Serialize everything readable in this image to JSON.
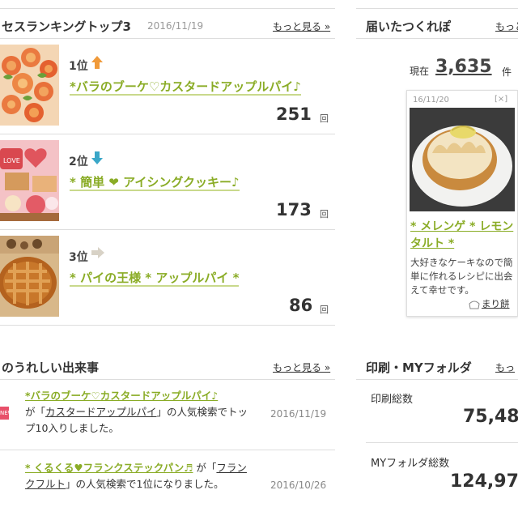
{
  "ranking": {
    "title": "セスランキングトップ3",
    "date": "2016/11/19",
    "more": "もっと見る »",
    "items": [
      {
        "rank": "1位",
        "trend": "up",
        "title": "*バラのブーケ♡カスタードアップルパイ♪",
        "count": "251",
        "unit": "回"
      },
      {
        "rank": "2位",
        "trend": "down",
        "title": "* 簡単 ❤ アイシングクッキー♪",
        "count": "173",
        "unit": "回"
      },
      {
        "rank": "3位",
        "trend": "same",
        "title": "* パイの王様 * アップルパイ *",
        "count": "86",
        "unit": "回"
      }
    ]
  },
  "tsukurepo": {
    "title": "届いたつくれぽ",
    "more": "もっと",
    "current_label": "現在",
    "count": "3,635",
    "unit": "件",
    "card": {
      "date": "16/11/20",
      "close": "[×]",
      "title": "* メレンゲ * レモンタルト *",
      "text": "大好きなケーキなので簡単に作れるレシピに出会えて幸せです。",
      "user": "まり餅"
    }
  },
  "events": {
    "title": "のうれしい出来事",
    "more": "もっと見る »",
    "items": [
      {
        "badge": "NEW",
        "link": "*バラのブーケ♡カスタードアップルパイ♪",
        "prefix": "が「",
        "keyword": "カスタードアップルパイ",
        "suffix": "」の人気検索でトップ10入りしました。",
        "date": "2016/11/19"
      },
      {
        "link": "* くるくる♥フランクステックパン♬",
        "prefix": " が「",
        "keyword": "フランクフルト",
        "suffix": "」の人気検索で1位になりました。",
        "date": "2016/10/26"
      }
    ]
  },
  "print": {
    "title": "印刷・MYフォルダ",
    "more": "もっ",
    "print_label": "印刷総数",
    "print_value": "75,48",
    "folder_label": "MYフォルダ総数",
    "folder_value": "124,97"
  }
}
